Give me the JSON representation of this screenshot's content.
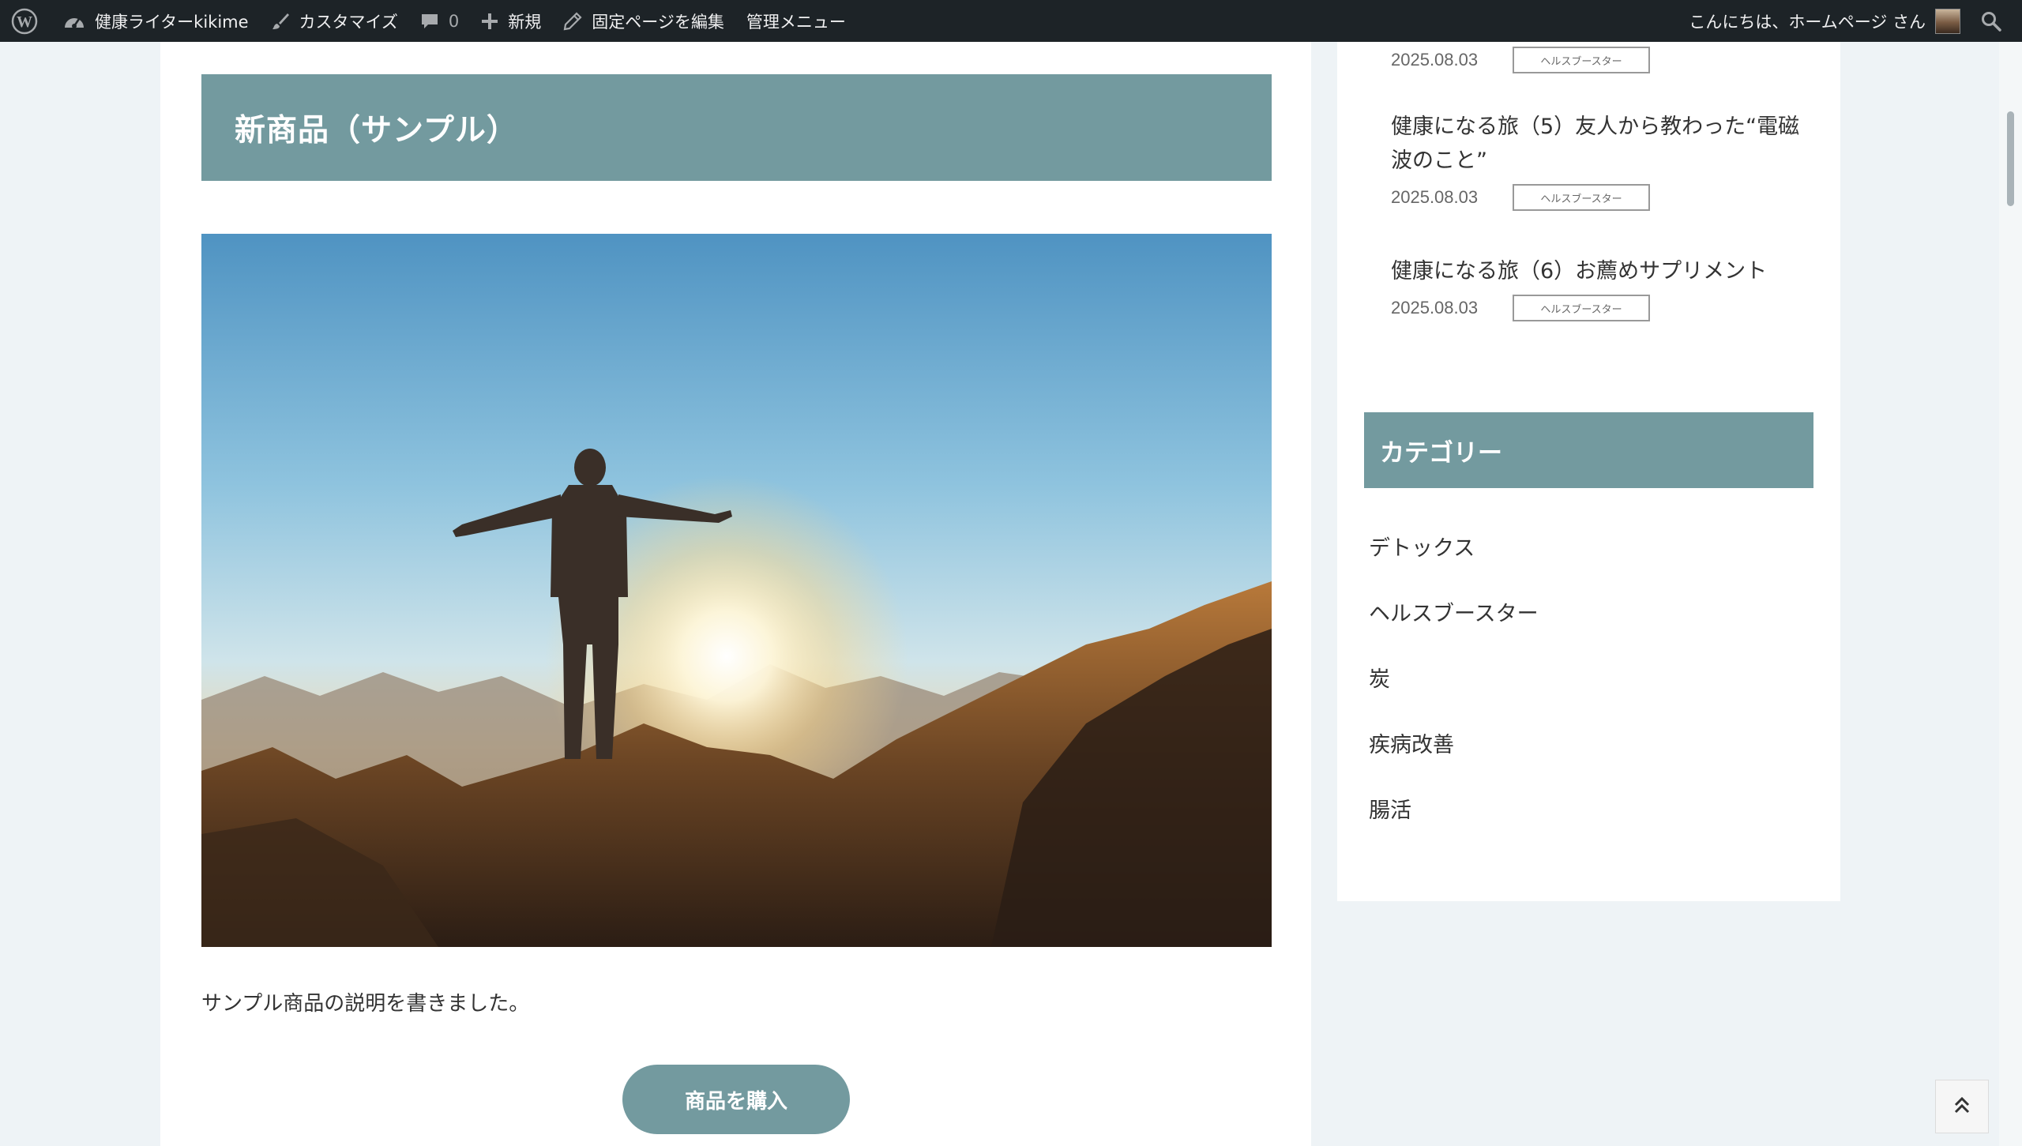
{
  "admin_bar": {
    "site_name": "健康ライターkikime",
    "customize": "カスタマイズ",
    "comments_count": "0",
    "new": "新規",
    "edit_page": "固定ページを編集",
    "admin_menu": "管理メニュー",
    "greeting": "こんにちは、ホームページ さん"
  },
  "main": {
    "title": "新商品（サンプル）",
    "hero_image": "sunrise-mountain-person",
    "description": "サンプル商品の説明を書きました。",
    "buy_button": "商品を購入"
  },
  "sidebar": {
    "recent_posts": [
      {
        "title": "",
        "date": "2025.08.03",
        "tag": "ヘルスブースター"
      },
      {
        "title": "健康になる旅（5）友人から教わった“電磁波のこと”",
        "date": "2025.08.03",
        "tag": "ヘルスブースター"
      },
      {
        "title": "健康になる旅（6）お薦めサプリメント",
        "date": "2025.08.03",
        "tag": "ヘルスブースター"
      }
    ],
    "categories_heading": "カテゴリー",
    "categories": [
      "デトックス",
      "ヘルスブースター",
      "炭",
      "疾病改善",
      "腸活"
    ]
  },
  "colors": {
    "accent": "#739a9f",
    "admin_bar_bg": "#1d2327",
    "page_bg": "#eef3f6"
  },
  "icons": {
    "wordpress": "wordpress-logo-icon",
    "dashboard": "dashboard-icon",
    "customize": "brush-icon",
    "comments": "comment-icon",
    "new": "plus-icon",
    "edit": "pencil-icon",
    "search": "search-icon",
    "back_to_top": "double-chevron-up-icon"
  }
}
